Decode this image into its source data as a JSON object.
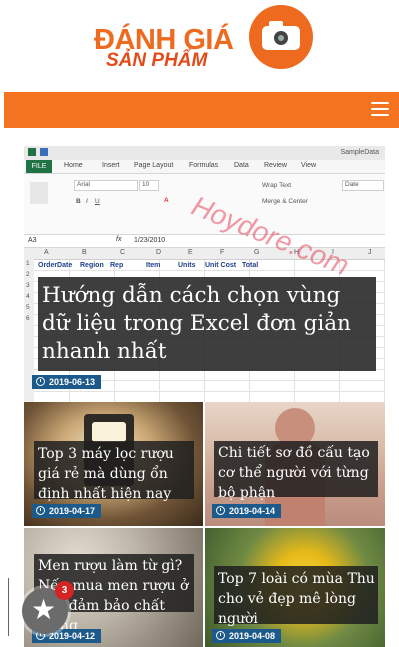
{
  "logo": {
    "line1": "ĐÁNH GIÁ",
    "line2": "SẢN PHẨM"
  },
  "featured": {
    "title": "Hướng dẫn cách chọn vùng dữ liệu trong Excel đơn giản nhanh nhất",
    "date": "2019-06-13",
    "screenshot": {
      "filename": "SampleData",
      "tabs": [
        "FILE",
        "Home",
        "Insert",
        "Page Layout",
        "Formulas",
        "Data",
        "Review",
        "View"
      ],
      "font_name": "Arial",
      "font_size": "10",
      "wrap_text": "Wrap Text",
      "merge_center": "Merge & Center",
      "number_format": "Date",
      "cell_ref": "A3",
      "formula": "1/23/2010",
      "watermark": "Hoydore.com",
      "col_letters": [
        "A",
        "B",
        "C",
        "D",
        "E",
        "F",
        "G",
        "H",
        "I",
        "J"
      ],
      "headers": [
        "OrderDate",
        "Region",
        "Rep",
        "Item",
        "Units",
        "Unit Cost",
        "Total"
      ]
    }
  },
  "articles": [
    {
      "title": "Top 3 máy lọc rượu giá rẻ mà dùng ổn định nhất hiện nay",
      "date": "2019-04-17"
    },
    {
      "title": "Chi tiết sơ đồ cấu tạo cơ thể người với từng bộ phận",
      "date": "2019-04-14"
    },
    {
      "title": "Men rượu làm từ gì? Nếu mua men rượu ở đâu đảm bảo chất lượng",
      "date": "2019-04-12"
    },
    {
      "title": "Top 7 loài có mùa Thu cho vẻ đẹp mê lòng người",
      "date": "2019-04-08"
    }
  ],
  "share": {
    "badge_count": "3"
  },
  "colors": {
    "accent": "#f47320",
    "date_badge": "#1d5a8c"
  }
}
